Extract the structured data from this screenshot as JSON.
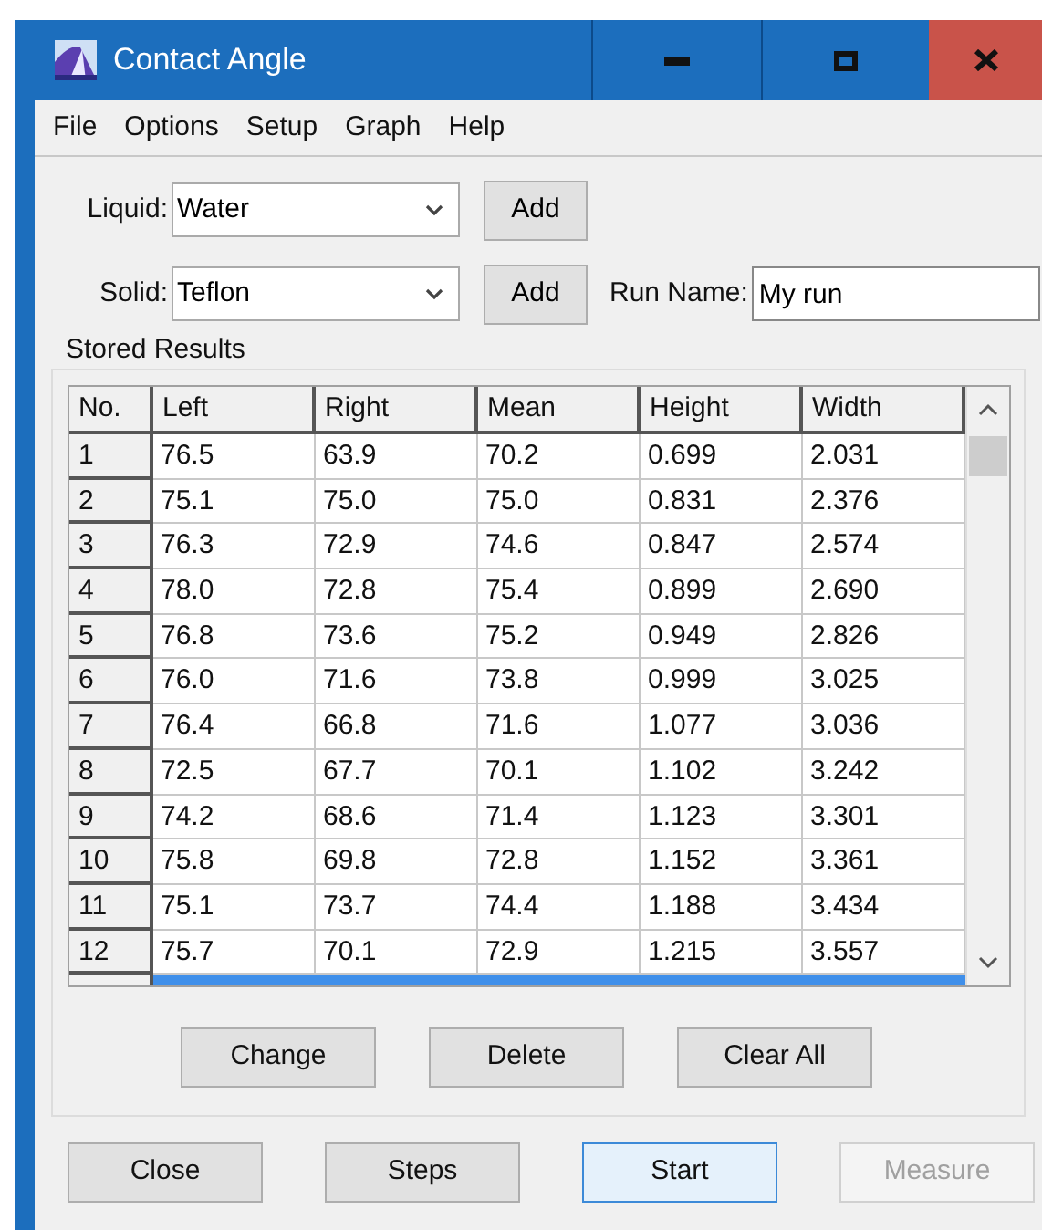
{
  "window": {
    "title": "Contact Angle"
  },
  "menu": [
    "File",
    "Options",
    "Setup",
    "Graph",
    "Help"
  ],
  "liquid": {
    "label": "Liquid:",
    "value": "Water",
    "button": "Add"
  },
  "solid": {
    "label": "Solid:",
    "value": "Teflon",
    "button": "Add"
  },
  "run_name": {
    "label": "Run Name:",
    "value": "My run"
  },
  "stored_results": {
    "title": "Stored Results",
    "columns": [
      "No.",
      "Left",
      "Right",
      "Mean",
      "Height",
      "Width"
    ],
    "rows": [
      {
        "cells": [
          "1",
          "76.5",
          "63.9",
          "70.2",
          "0.699",
          "2.031"
        ],
        "selected": false
      },
      {
        "cells": [
          "2",
          "75.1",
          "75.0",
          "75.0",
          "0.831",
          "2.376"
        ],
        "selected": false
      },
      {
        "cells": [
          "3",
          "76.3",
          "72.9",
          "74.6",
          "0.847",
          "2.574"
        ],
        "selected": false
      },
      {
        "cells": [
          "4",
          "78.0",
          "72.8",
          "75.4",
          "0.899",
          "2.690"
        ],
        "selected": false
      },
      {
        "cells": [
          "5",
          "76.8",
          "73.6",
          "75.2",
          "0.949",
          "2.826"
        ],
        "selected": false
      },
      {
        "cells": [
          "6",
          "76.0",
          "71.6",
          "73.8",
          "0.999",
          "3.025"
        ],
        "selected": false
      },
      {
        "cells": [
          "7",
          "76.4",
          "66.8",
          "71.6",
          "1.077",
          "3.036"
        ],
        "selected": false
      },
      {
        "cells": [
          "8",
          "72.5",
          "67.7",
          "70.1",
          "1.102",
          "3.242"
        ],
        "selected": false
      },
      {
        "cells": [
          "9",
          "74.2",
          "68.6",
          "71.4",
          "1.123",
          "3.301"
        ],
        "selected": false
      },
      {
        "cells": [
          "10",
          "75.8",
          "69.8",
          "72.8",
          "1.152",
          "3.361"
        ],
        "selected": false
      },
      {
        "cells": [
          "11",
          "75.1",
          "73.7",
          "74.4",
          "1.188",
          "3.434"
        ],
        "selected": false
      },
      {
        "cells": [
          "12",
          "75.7",
          "70.1",
          "72.9",
          "1.215",
          "3.557"
        ],
        "selected": false
      },
      {
        "selected": true
      }
    ],
    "buttons": [
      "Change",
      "Delete",
      "Clear All"
    ]
  },
  "footer_buttons": [
    {
      "label": "Close",
      "disabled": false,
      "default": false
    },
    {
      "label": "Steps",
      "disabled": false,
      "default": false
    },
    {
      "label": "Start",
      "disabled": false,
      "default": true
    },
    {
      "label": "Measure",
      "disabled": true,
      "default": false
    }
  ]
}
